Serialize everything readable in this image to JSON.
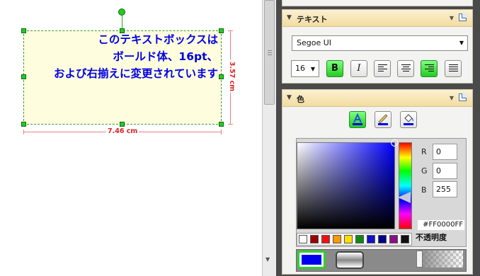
{
  "canvas": {
    "textbox_lines": [
      "このテキストボックスは",
      "ボールド体、16pt、",
      "および右揃えに変更されています"
    ],
    "width_label": "7.46 cm",
    "height_label": "3.57 cm"
  },
  "panel": {
    "text_section": {
      "title": "テキスト",
      "font": "Segoe UI",
      "size": "16",
      "bold_label": "B",
      "italic_label": "I",
      "bold_active": true,
      "italic_active": false,
      "alignment_active": "right"
    },
    "color_section": {
      "title": "色",
      "active_mode": "text-color",
      "r_label": "R",
      "g_label": "G",
      "b_label": "B",
      "r": "0",
      "g": "0",
      "b": "255",
      "hex": "#FF0000FF",
      "opacity_label": "不透明度",
      "swatches": [
        "#ffffff",
        "#990000",
        "#ee1111",
        "#ff9900",
        "#ffdd00",
        "#118811",
        "#1111cc",
        "#000088",
        "#881188",
        "#111111"
      ]
    }
  }
}
